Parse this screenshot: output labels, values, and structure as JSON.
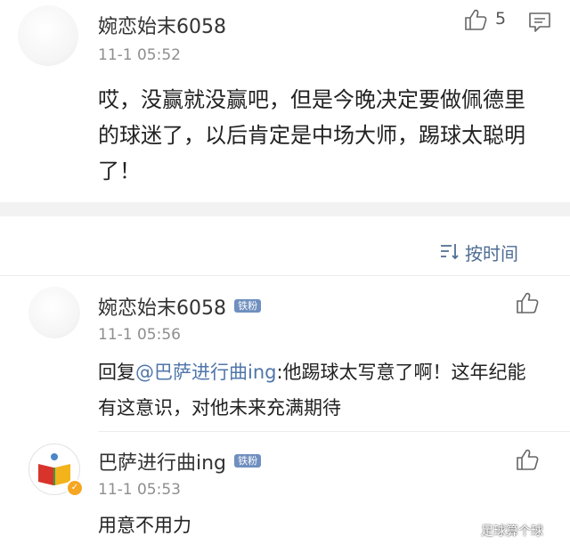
{
  "main_comment": {
    "username": "婉恋始末6058",
    "time": "11-1 05:52",
    "like_count": "5",
    "text": "哎，没赢就没赢吧，但是今晚决定要做佩德里的球迷了，以后肯定是中场大师，踢球太聪明了！"
  },
  "sort": {
    "label": "按时间"
  },
  "replies": [
    {
      "username": "婉恋始末6058",
      "badge": "铁粉",
      "time": "11-1 05:56",
      "reply_prefix": "回复",
      "mention": "@巴萨进行曲ing",
      "text": ":他踢球太写意了啊！这年纪能有这意识，对他未来充满期待"
    },
    {
      "username": "巴萨进行曲ing",
      "badge": "铁粉",
      "time": "11-1 05:53",
      "text": "用意不用力"
    }
  ],
  "watermark": "足球算个球",
  "colors": {
    "accent": "#4f76aa",
    "badge": "#6f8fbf",
    "band": "#f2f2f2"
  }
}
